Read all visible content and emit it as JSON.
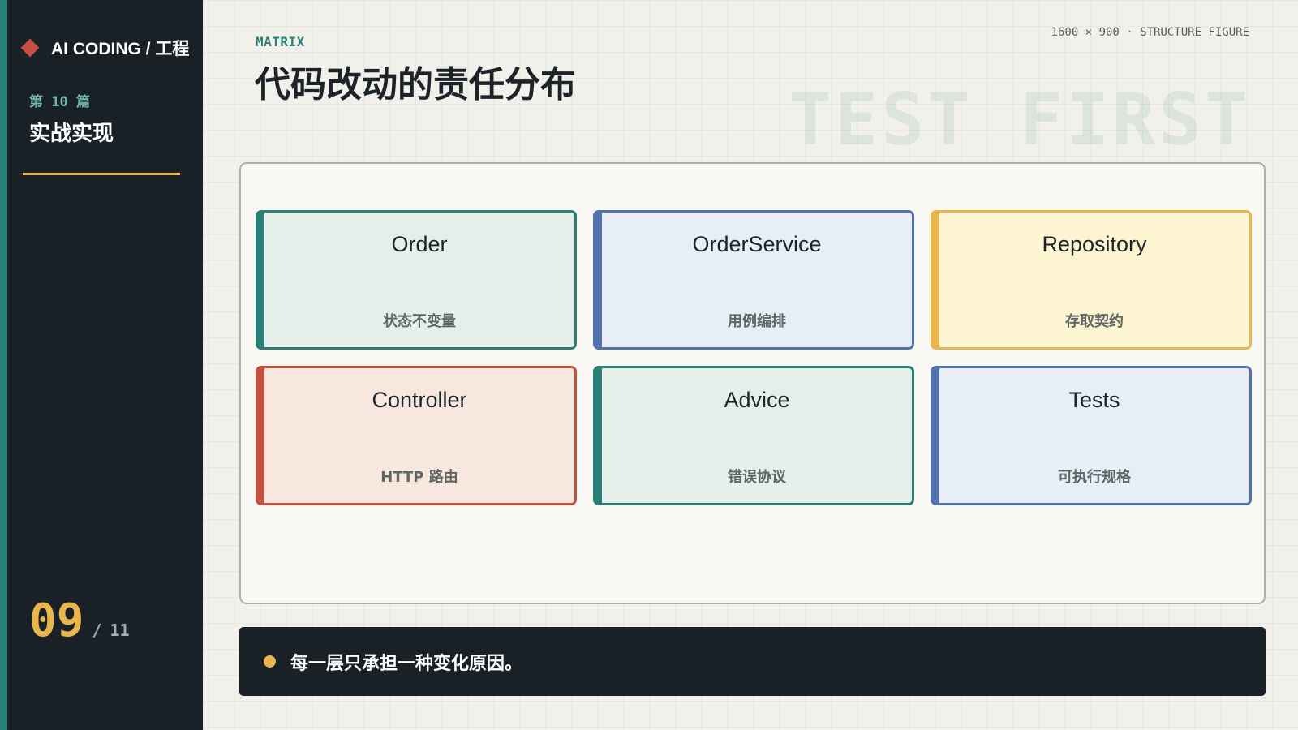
{
  "sidebar": {
    "brand": "AI CODING / 工程",
    "chapter": "第 10 篇",
    "section": "实战实现",
    "page_current": "09",
    "page_separator": "/",
    "page_total": "11"
  },
  "header": {
    "eyebrow": "MATRIX",
    "title": "代码改动的责任分布",
    "meta": "1600 × 900 · STRUCTURE FIGURE",
    "watermark": "TEST FIRST"
  },
  "cards": [
    {
      "title": "Order",
      "desc": "状态不变量"
    },
    {
      "title": "OrderService",
      "desc": "用例编排"
    },
    {
      "title": "Repository",
      "desc": "存取契约"
    },
    {
      "title": "Controller",
      "desc": "HTTP 路由"
    },
    {
      "title": "Advice",
      "desc": "错误协议"
    },
    {
      "title": "Tests",
      "desc": "可执行规格"
    }
  ],
  "takeaway": "每一层只承担一种变化原因。",
  "colors": {
    "teal": "#2a7f77",
    "blue": "#5273ab",
    "gold": "#e8b64c",
    "red": "#c4503f",
    "dark": "#192026"
  }
}
